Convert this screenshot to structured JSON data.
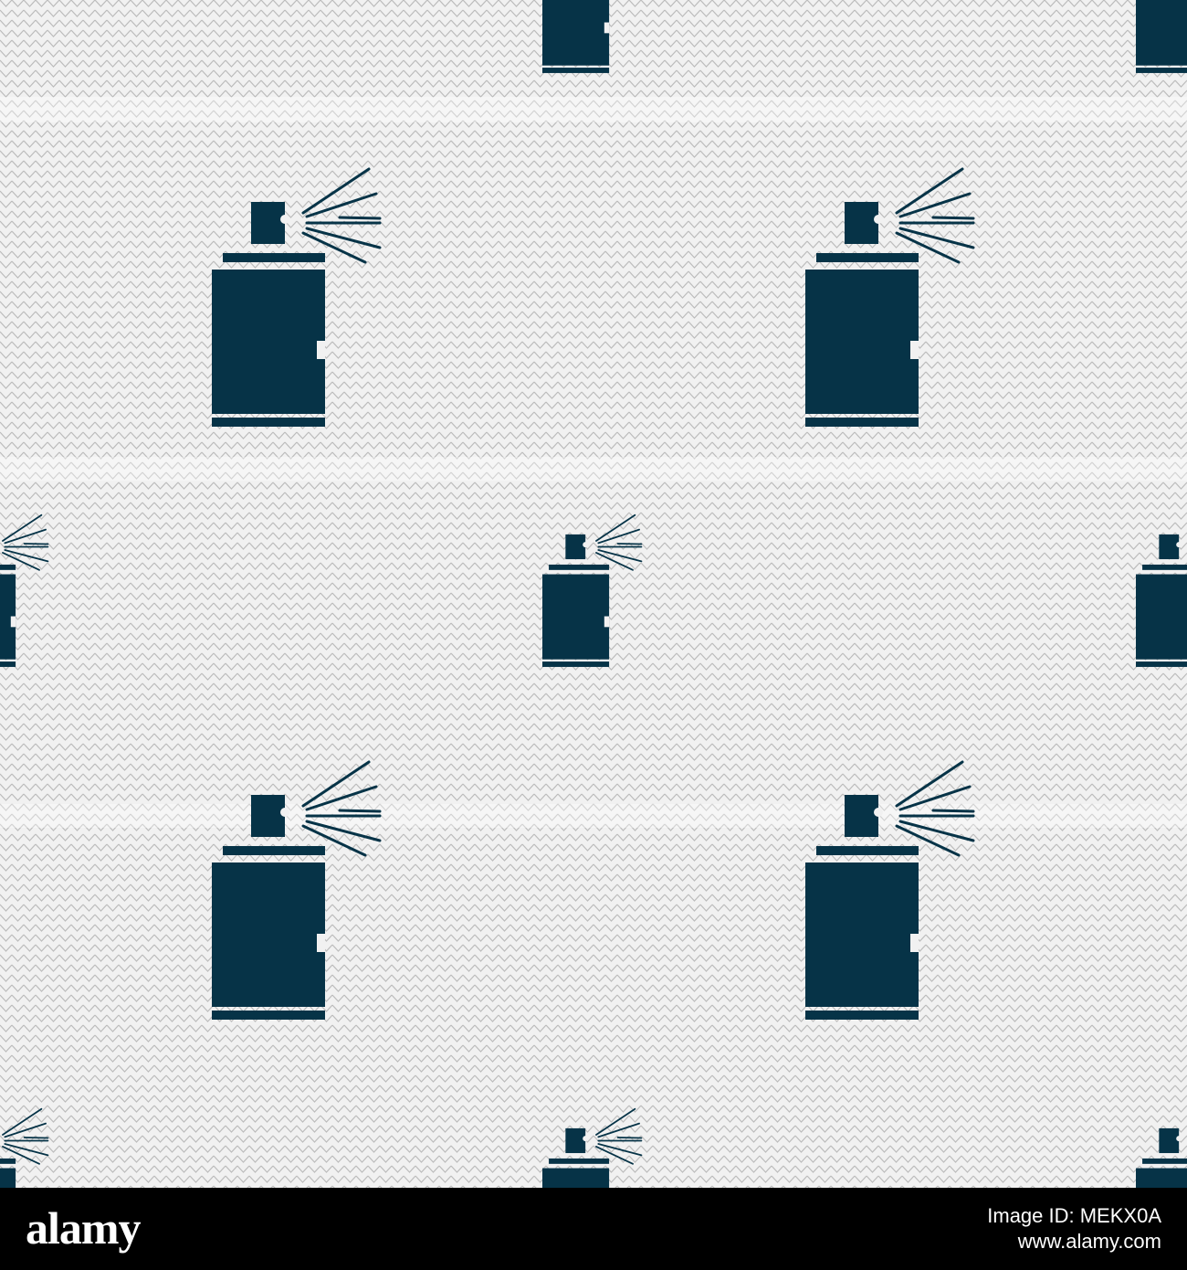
{
  "pattern": {
    "background_color": "#f1f1f1",
    "chevron_color": "#bcbcbc",
    "icon_color": "#063347",
    "icon_name": "spray-can-icon"
  },
  "footer": {
    "logo_text": "alamy",
    "image_id_label": "Image ID: MEKX0A",
    "site_url": "www.alamy.com"
  }
}
